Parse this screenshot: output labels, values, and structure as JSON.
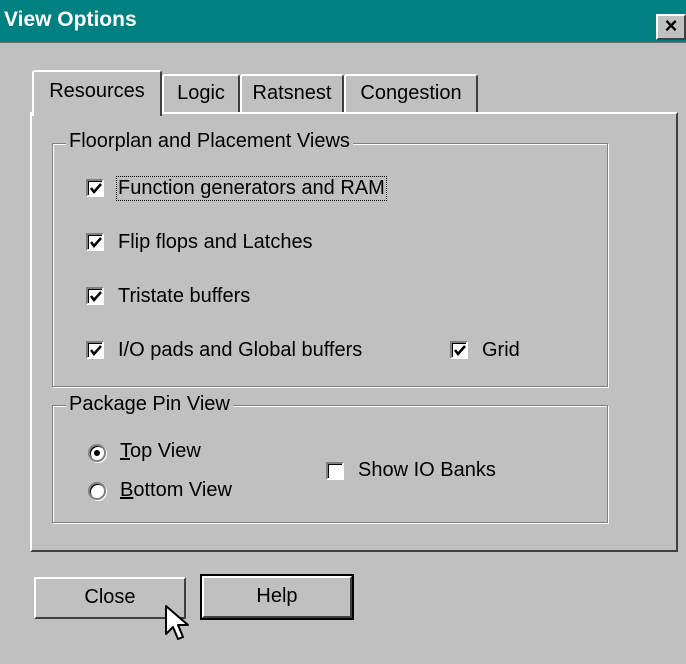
{
  "window": {
    "title": "View Options",
    "close_glyph": "×"
  },
  "tabs": [
    {
      "label": "Resources",
      "active": true
    },
    {
      "label": "Logic",
      "active": false
    },
    {
      "label": "Ratsnest",
      "active": false
    },
    {
      "label": "Congestion",
      "active": false
    }
  ],
  "floorplan": {
    "legend": "Floorplan and Placement Views",
    "items": [
      {
        "label": "Function generators and RAM",
        "checked": true
      },
      {
        "label": "Flip flops and Latches",
        "checked": true
      },
      {
        "label": "Tristate buffers",
        "checked": true
      },
      {
        "label": "I/O pads and Global buffers",
        "checked": true
      }
    ],
    "grid": {
      "label": "Grid",
      "checked": true
    }
  },
  "package": {
    "legend": "Package Pin View",
    "top_view": {
      "mnemonic": "T",
      "rest": "op View",
      "selected": true
    },
    "bottom_view": {
      "mnemonic": "B",
      "rest": "ottom View",
      "selected": false
    },
    "show_io_banks": {
      "label": "Show IO Banks",
      "checked": false
    }
  },
  "buttons": {
    "close": "Close",
    "help": "Help"
  },
  "icons": {
    "checkmark": "checkmark-icon",
    "cursor": "arrow-cursor-icon"
  }
}
